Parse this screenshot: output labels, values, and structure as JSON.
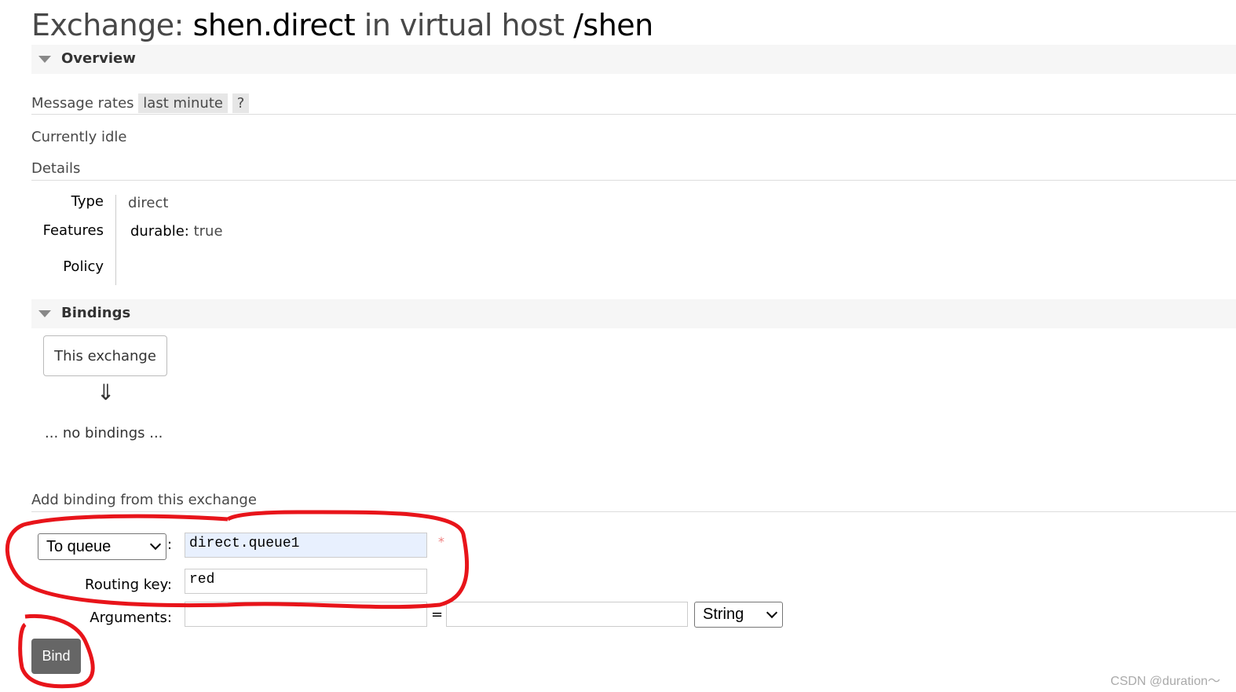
{
  "title": {
    "prefix": "Exchange: ",
    "name": "shen.direct",
    "middle": " in virtual host ",
    "vhost": "/shen"
  },
  "overview": {
    "heading": "Overview",
    "message_rates_label": "Message rates",
    "rate_period": "last minute",
    "help": "?",
    "status": "Currently idle",
    "details_label": "Details",
    "details": {
      "type_label": "Type",
      "type_value": "direct",
      "features_label": "Features",
      "durable_label": "durable:",
      "durable_value": "true",
      "policy_label": "Policy"
    }
  },
  "bindings": {
    "heading": "Bindings",
    "this_exchange": "This exchange",
    "arrow": "⇓",
    "empty": "... no bindings ..."
  },
  "add_binding": {
    "heading": "Add binding from this exchange",
    "destination_type": "To queue",
    "colon": ":",
    "destination_value": "direct.queue1",
    "required_mark": "*",
    "routing_key_label": "Routing key:",
    "routing_key_value": "red",
    "arguments_label": "Arguments:",
    "arguments_key": "",
    "equals": "=",
    "arguments_value": "",
    "arguments_type": "String",
    "bind_button": "Bind"
  },
  "watermark": "CSDN @duration～",
  "colors": {
    "annotation": "#e8141a",
    "input_highlight": "#e8f0fe",
    "button": "#666666"
  }
}
